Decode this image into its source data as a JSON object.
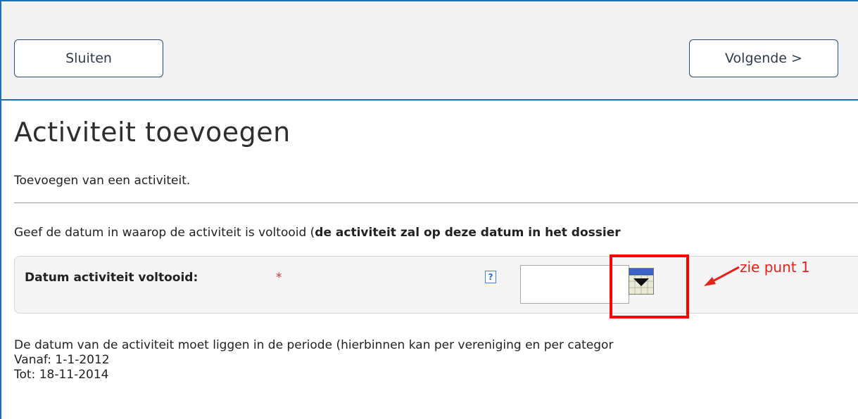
{
  "toolbar": {
    "close_label": "Sluiten",
    "next_label": "Volgende >"
  },
  "page": {
    "title": "Activiteit toevoegen",
    "subtitle": "Toevoegen van een activiteit.",
    "instruction_prefix": "Geef de datum in waarop de activiteit is voltooid (",
    "instruction_bold": "de activiteit zal op deze datum in het dossier"
  },
  "form": {
    "date_field": {
      "label": "Datum activiteit voltooid:",
      "required_marker": "*",
      "help_icon_text": "?",
      "value": "",
      "placeholder": ""
    }
  },
  "annotation": {
    "text": "zie punt 1",
    "color": "#e8211b"
  },
  "period": {
    "description": "De datum van de activiteit moet liggen in de periode (hierbinnen kan per vereniging en per categor",
    "from": "Vanaf: 1-1-2012",
    "to": "Tot: 18-11-2014"
  },
  "colors": {
    "accent_border": "#1f6fb2",
    "required": "#d9302c",
    "highlight": "#ff0000"
  }
}
